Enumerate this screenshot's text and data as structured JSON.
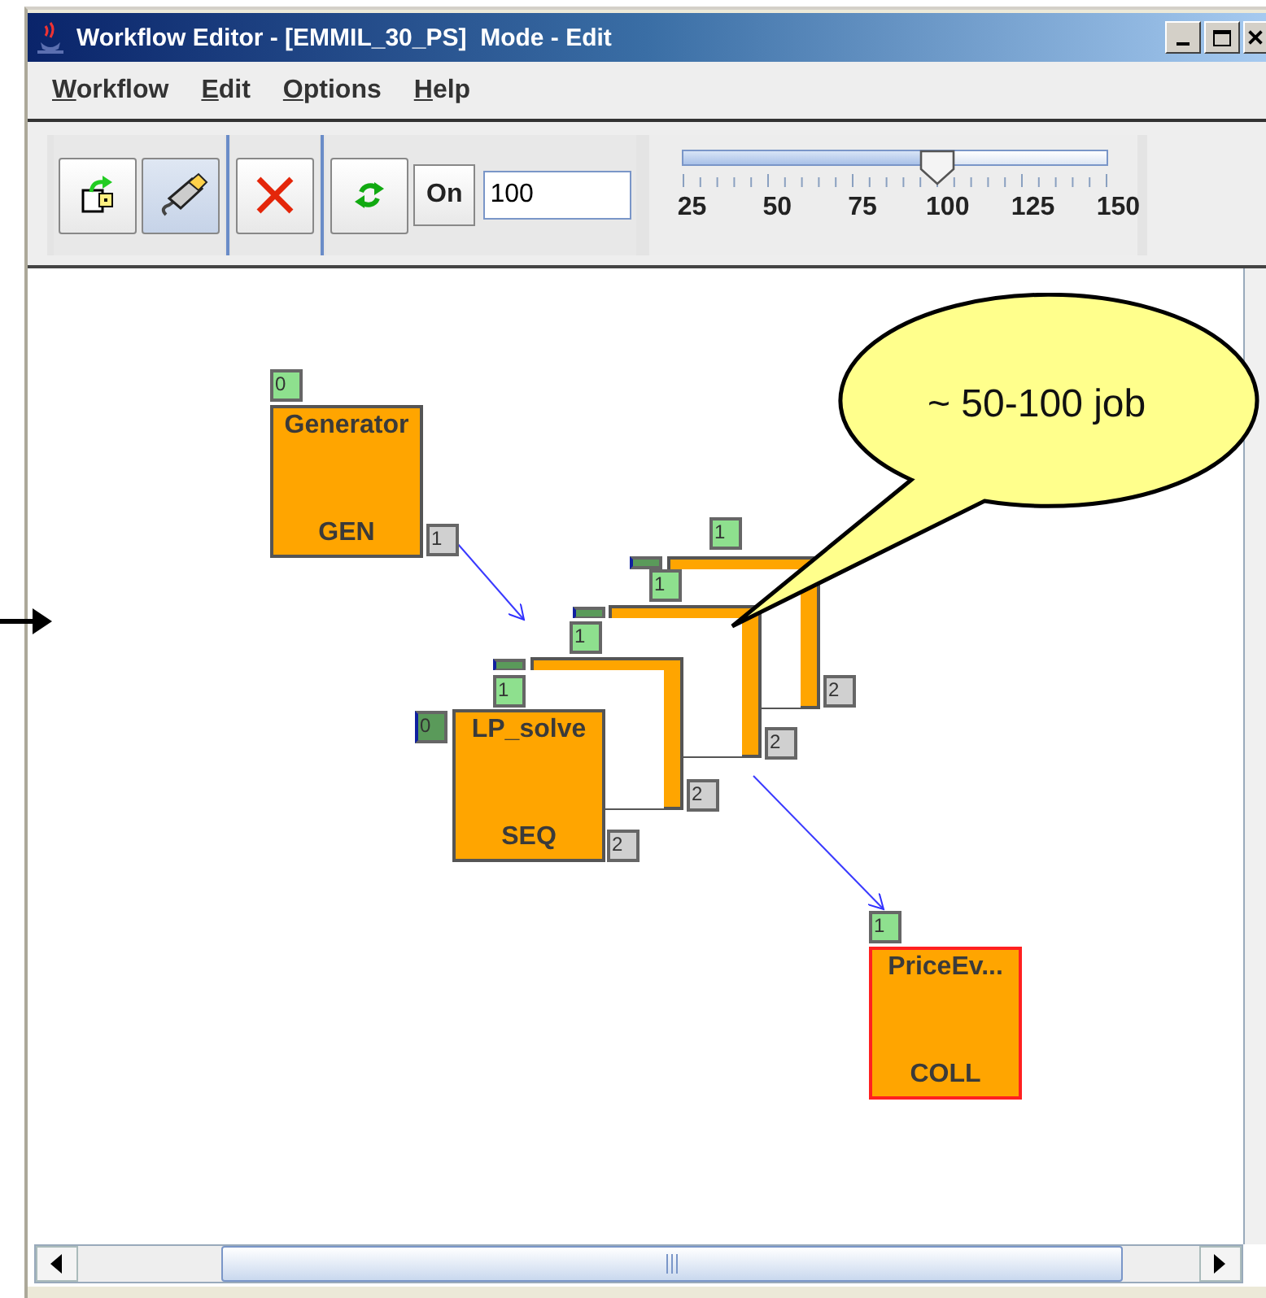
{
  "window": {
    "title": "Workflow Editor - [EMMIL_30_PS]  Mode - Edit"
  },
  "menu": [
    {
      "label": "Workflow"
    },
    {
      "label": "Edit"
    },
    {
      "label": "Options"
    },
    {
      "label": "Help"
    }
  ],
  "toolbar": {
    "toggle_label": "On",
    "zoom_value": "100",
    "zoom_slider": {
      "level": 0.6,
      "tick_labels": [
        "25",
        "50",
        "75",
        "100",
        "125",
        "150"
      ]
    }
  },
  "nodes": [
    {
      "kind": "node",
      "title": "Generator",
      "type": "GEN",
      "selected": false,
      "ports": [
        {
          "kind": "input",
          "label": "0"
        },
        {
          "kind": "output",
          "label": "1"
        }
      ]
    },
    {
      "kind": "ghost",
      "ports": [
        {
          "kind": "input",
          "label": "1"
        },
        {
          "kind": "control"
        },
        {
          "kind": "output",
          "label": "2"
        }
      ]
    },
    {
      "kind": "ghost",
      "ports": [
        {
          "kind": "input",
          "label": "1"
        },
        {
          "kind": "control"
        },
        {
          "kind": "output",
          "label": "2"
        }
      ]
    },
    {
      "kind": "ghost",
      "ports": [
        {
          "kind": "input",
          "label": "1"
        },
        {
          "kind": "control"
        },
        {
          "kind": "output",
          "label": "2"
        }
      ]
    },
    {
      "kind": "node",
      "title": "LP_solve",
      "type": "SEQ",
      "selected": false,
      "ports": [
        {
          "kind": "input",
          "label": "1"
        },
        {
          "kind": "control",
          "label": "0"
        },
        {
          "kind": "output",
          "label": "2"
        }
      ]
    },
    {
      "kind": "node",
      "title": "PriceEv...",
      "type": "COLL",
      "selected": true,
      "ports": [
        {
          "kind": "input",
          "label": "1"
        }
      ]
    }
  ],
  "callout": {
    "text": "~ 50-100 job"
  }
}
